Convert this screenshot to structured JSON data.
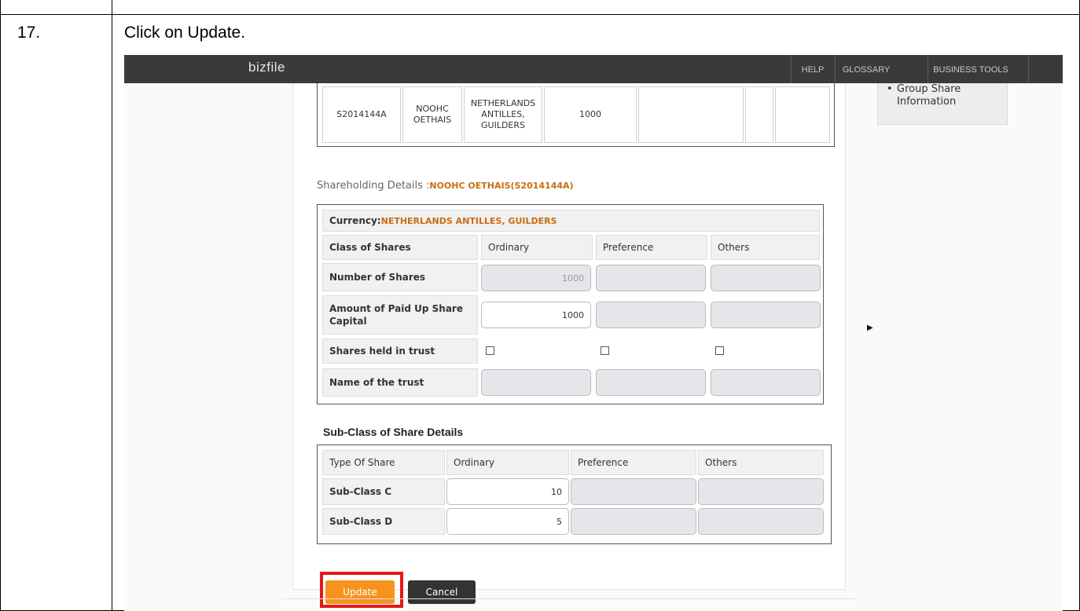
{
  "step": {
    "number": "17.",
    "instruction": "Click on Update."
  },
  "nav": {
    "logo": "bizfile",
    "links": [
      "HELP",
      "GLOSSARY",
      "BUSINESS TOOLS"
    ]
  },
  "side_menu": {
    "items": [
      "Group Share Information"
    ]
  },
  "top_table": {
    "id": "S2014144A",
    "name": "NOOHC OETHAIS",
    "currency": "NETHERLANDS ANTILLES, GUILDERS",
    "amount": "1000"
  },
  "shareholding": {
    "title": "Shareholding Details :",
    "holder": "NOOHC OETHAIS(S2014144A)",
    "currency_label": "Currency:",
    "currency_value": "NETHERLANDS ANTILLES, GUILDERS",
    "headers": [
      "Class of Shares",
      "Ordinary",
      "Preference",
      "Others"
    ],
    "rows": [
      {
        "label": "Number of Shares",
        "ordinary": "1000"
      },
      {
        "label": "Amount of Paid Up Share Capital",
        "ordinary": "1000"
      },
      {
        "label": "Shares held in trust"
      },
      {
        "label": "Name of the trust"
      }
    ]
  },
  "subclass": {
    "title": "Sub-Class of Share Details",
    "headers": [
      "Type Of Share",
      "Ordinary",
      "Preference",
      "Others"
    ],
    "rows": [
      {
        "label": "Sub-Class C",
        "ordinary": "10"
      },
      {
        "label": "Sub-Class D",
        "ordinary": "5"
      }
    ]
  },
  "buttons": {
    "update": "Update",
    "cancel": "Cancel"
  },
  "colors": {
    "accent": "#f5931e",
    "highlight": "#e61818",
    "navbar": "#3a3a3a"
  }
}
